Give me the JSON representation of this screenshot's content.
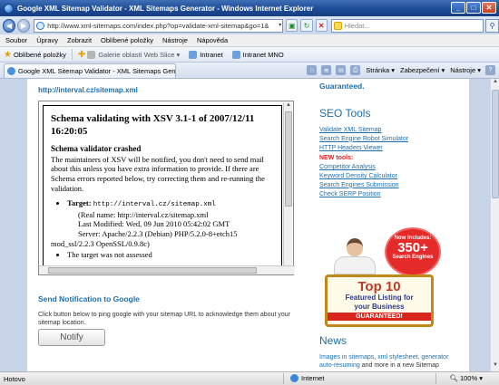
{
  "window": {
    "title": "Google XML Sitemap Validator - XML Sitemaps Generator - Windows Internet Explorer",
    "minimize": "_",
    "maximize": "□",
    "close": "✕"
  },
  "address": {
    "url": "http://www.xml-sitemaps.com/index.php?op=validate-xml-sitemap&go=1&",
    "search_placeholder": "Hledat..."
  },
  "menu": [
    "Soubor",
    "Úpravy",
    "Zobrazit",
    "Oblíbené položky",
    "Nástroje",
    "Nápověda"
  ],
  "favorites": {
    "label": "Oblíbené položky",
    "items": [
      "Galerie oblastí Web Slice ▾",
      "Intranet",
      "Intranet MNO"
    ]
  },
  "tab": {
    "label": "Google XML Sitemap Validator - XML Sitemaps Generator"
  },
  "commands": {
    "page": "Stránka ▾",
    "security": "Zabezpečení ▾",
    "tools": "Nástroje ▾",
    "help": "?"
  },
  "main": {
    "sitemap_url": "http://interval.cz/sitemap.xml",
    "report": {
      "heading": "Schema validating with XSV 3.1-1 of 2007/12/11 16:20:05",
      "crash_title": "Schema validator crashed",
      "crash_text": "The maintainers of XSV will be notified, you don't need to send mail about this unless you have extra information to provide. If there are Schema errors reported below, try correcting them and re-running the validation.",
      "target_label": "Target:",
      "target_url": "http://interval.cz/sitemap.xml",
      "real_name": "(Real name: http://interval.cz/sitemap.xml",
      "last_modified": "Last Modified: Wed, 09 Jun 2010 05:42:02 GMT",
      "server": "Server: Apache/2.2.3 (Debian) PHP/5.2.0-8+etch15",
      "mod_ssl": "mod_ssl/2.2.3 OpenSSL/0.9.8c)",
      "not_assessed": "The target was not assessed"
    },
    "notify": {
      "title": "Send Notification to Google",
      "description": "Click button below to ping google with your sitemap URL to acknowledge them about your sitemap location.",
      "button": "Notify"
    }
  },
  "sidebar": {
    "guaranteed": "Guaranteed.",
    "seo_title": "SEO Tools",
    "links": [
      "Validate XML Sitemap",
      "Search Engine Robot Simulator",
      "HTTP Headers Viewer"
    ],
    "new_label": "NEW tools:",
    "new_links": [
      "Competitor Analysis",
      "Keyword Density Calculator",
      "Search Engines Submission",
      "Check SERP Position"
    ],
    "ad": {
      "burst_top": "Now Includes:",
      "burst_number": "350+",
      "burst_bottom": "Search Engines",
      "line1": "Top 10",
      "line2": "Featured Listing for",
      "line3": "your Business",
      "line4": "GUARANTEED!"
    },
    "news_title": "News",
    "news_link": "Images in sitemaps, xml stylesheet, generator auto-resuming",
    "news_rest": " and more in a new Sitemap"
  },
  "status": {
    "text": "Hotovo",
    "zone": "Internet",
    "zoom": "100%"
  }
}
